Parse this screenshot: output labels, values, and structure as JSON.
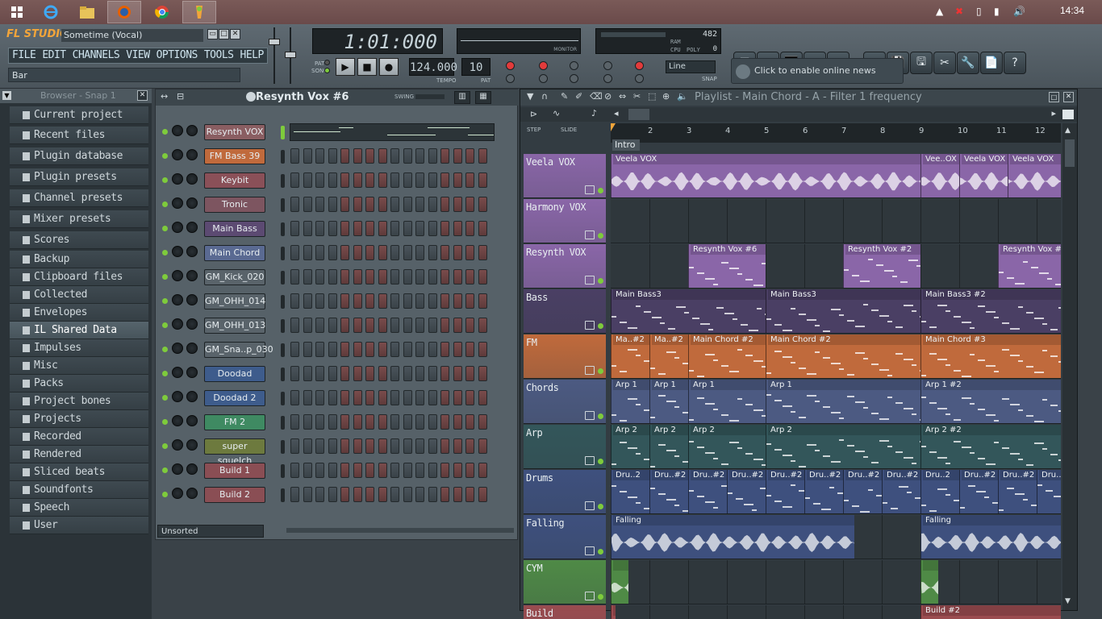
{
  "taskbar": {
    "clock": "14:34",
    "apps": [
      "windows-start",
      "internet-explorer",
      "file-explorer",
      "firefox",
      "chrome",
      "fl-studio"
    ]
  },
  "app": {
    "logo": "FL STUDIO",
    "song_title": "Sometime (Vocal)",
    "menu": [
      "FILE",
      "EDIT",
      "CHANNELS",
      "VIEW",
      "OPTIONS",
      "TOOLS",
      "HELP"
    ],
    "hint": "Bar",
    "time_display": "1:01:000",
    "tempo": "124.000",
    "tempo_label": "TEMPO",
    "pattern": "10",
    "pattern_label": "PAT",
    "pat_song": [
      "PAT",
      "SONG"
    ],
    "monitor_label": "MONITOR",
    "cpu": {
      "value": "482",
      "ram_label": "RAM",
      "cpu_label": "CPU",
      "poly_label": "POLY",
      "poly": "0"
    },
    "snap": "Line",
    "snap_label": "SNAP",
    "news": "Click to enable online news"
  },
  "browser": {
    "header": "Browser - Snap 1",
    "active_index": 11,
    "items": [
      "Current project",
      "Recent files",
      "Plugin database",
      "Plugin presets",
      "Channel presets",
      "Mixer presets",
      "Scores",
      "Backup",
      "Clipboard files",
      "Collected",
      "Envelopes",
      "IL Shared Data",
      "Impulses",
      "Misc",
      "Packs",
      "Project bones",
      "Projects",
      "Recorded",
      "Rendered",
      "Sliced beats",
      "Soundfonts",
      "Speech",
      "User"
    ]
  },
  "rack": {
    "title": "Resynth Vox #6",
    "swing_label": "SWING",
    "filter": "Unsorted",
    "channels": [
      {
        "name": "Resynth VOX",
        "color": "#8a5e62"
      },
      {
        "name": "FM Bass 39",
        "color": "#c06a3c"
      },
      {
        "name": "Keybit",
        "color": "#8a5058"
      },
      {
        "name": "Tronic",
        "color": "#7d5560"
      },
      {
        "name": "Main Bass",
        "color": "#5c4a72"
      },
      {
        "name": "Main Chord",
        "color": "#5a6a92"
      },
      {
        "name": "GM_Kick_020",
        "color": "#59636a"
      },
      {
        "name": "GM_OHH_014",
        "color": "#59636a"
      },
      {
        "name": "GM_OHH_013",
        "color": "#59636a"
      },
      {
        "name": "GM_Sna..p_030",
        "color": "#59636a"
      },
      {
        "name": "Doodad",
        "color": "#3e5c8c"
      },
      {
        "name": "Doodad 2",
        "color": "#3e5c8c"
      },
      {
        "name": "FM 2",
        "color": "#3f8a62"
      },
      {
        "name": "super squelch",
        "color": "#6d7a3e"
      },
      {
        "name": "Build 1",
        "color": "#8a4e54"
      },
      {
        "name": "Build 2",
        "color": "#8a4e54"
      }
    ]
  },
  "playlist": {
    "title": "Playlist - Main Chord - A - Filter 1 frequency",
    "step_label": "STEP",
    "slide_label": "SLIDE",
    "marker": "Intro",
    "bars": [
      "2",
      "3",
      "4",
      "5",
      "6",
      "7",
      "8",
      "9",
      "10",
      "11",
      "12"
    ],
    "tracks": [
      {
        "name": "Veela VOX",
        "color": "#8a66a8",
        "clips": [
          {
            "label": "Veela VOX",
            "start": 0,
            "len": 8,
            "kind": "audio"
          },
          {
            "label": "Vee..OX",
            "start": 8,
            "len": 1,
            "kind": "audio"
          },
          {
            "label": "Veela VOX",
            "start": 9,
            "len": 1.25,
            "kind": "audio"
          },
          {
            "label": "Veela VOX",
            "start": 10.25,
            "len": 1.5,
            "kind": "audio"
          }
        ]
      },
      {
        "name": "Harmony VOX",
        "color": "#8a66a8",
        "clips": []
      },
      {
        "name": "Resynth VOX",
        "color": "#8a66a8",
        "clips": [
          {
            "label": "Resynth Vox #6",
            "start": 2,
            "len": 2,
            "kind": "pattern"
          },
          {
            "label": "Resynth Vox #2",
            "start": 6,
            "len": 2,
            "kind": "pattern"
          },
          {
            "label": "Resynth Vox #",
            "start": 10,
            "len": 1.75,
            "kind": "pattern"
          }
        ]
      },
      {
        "name": "Bass",
        "color": "#4a3f64",
        "clips": [
          {
            "label": "Main Bass3",
            "start": 0,
            "len": 4,
            "kind": "pattern"
          },
          {
            "label": "Main Bass3",
            "start": 4,
            "len": 4,
            "kind": "pattern"
          },
          {
            "label": "Main Bass3 #2",
            "start": 8,
            "len": 3.75,
            "kind": "pattern"
          }
        ]
      },
      {
        "name": "FM",
        "color": "#c06a3c",
        "clips": [
          {
            "label": "Ma..#2",
            "start": 0,
            "len": 1,
            "kind": "pattern"
          },
          {
            "label": "Ma..#2",
            "start": 1,
            "len": 1,
            "kind": "pattern"
          },
          {
            "label": "Main Chord #2",
            "start": 2,
            "len": 2,
            "kind": "pattern"
          },
          {
            "label": "Main Chord #2",
            "start": 4,
            "len": 4,
            "kind": "pattern"
          },
          {
            "label": "Main Chord #3",
            "start": 8,
            "len": 3.75,
            "kind": "pattern"
          }
        ]
      },
      {
        "name": "Chords",
        "color": "#4c5a82",
        "clips": [
          {
            "label": "Arp 1",
            "start": 0,
            "len": 1,
            "kind": "pattern"
          },
          {
            "label": "Arp 1",
            "start": 1,
            "len": 1,
            "kind": "pattern"
          },
          {
            "label": "Arp 1",
            "start": 2,
            "len": 2,
            "kind": "pattern"
          },
          {
            "label": "Arp 1",
            "start": 4,
            "len": 4,
            "kind": "pattern"
          },
          {
            "label": "Arp 1 #2",
            "start": 8,
            "len": 3.75,
            "kind": "pattern"
          }
        ]
      },
      {
        "name": "Arp",
        "color": "#33565a",
        "clips": [
          {
            "label": "Arp 2",
            "start": 0,
            "len": 1,
            "kind": "pattern"
          },
          {
            "label": "Arp 2",
            "start": 1,
            "len": 1,
            "kind": "pattern"
          },
          {
            "label": "Arp 2",
            "start": 2,
            "len": 2,
            "kind": "pattern"
          },
          {
            "label": "Arp 2",
            "start": 4,
            "len": 4,
            "kind": "pattern"
          },
          {
            "label": "Arp 2 #2",
            "start": 8,
            "len": 3.75,
            "kind": "pattern"
          }
        ]
      },
      {
        "name": "Drums",
        "color": "#3e507e",
        "clips": [
          {
            "label": "Dru..2",
            "start": 0,
            "len": 1,
            "kind": "pattern"
          },
          {
            "label": "Dru..#2",
            "start": 1,
            "len": 1,
            "kind": "pattern"
          },
          {
            "label": "Dru..#2",
            "start": 2,
            "len": 1,
            "kind": "pattern"
          },
          {
            "label": "Dru..#2",
            "start": 3,
            "len": 1,
            "kind": "pattern"
          },
          {
            "label": "Dru..#2",
            "start": 4,
            "len": 1,
            "kind": "pattern"
          },
          {
            "label": "Dru..#2",
            "start": 5,
            "len": 1,
            "kind": "pattern"
          },
          {
            "label": "Dru..#2",
            "start": 6,
            "len": 1,
            "kind": "pattern"
          },
          {
            "label": "Dru..#2",
            "start": 7,
            "len": 1,
            "kind": "pattern"
          },
          {
            "label": "Dru..2",
            "start": 8,
            "len": 1,
            "kind": "pattern"
          },
          {
            "label": "Dru..#2",
            "start": 9,
            "len": 1,
            "kind": "pattern"
          },
          {
            "label": "Dru..#2",
            "start": 10,
            "len": 1,
            "kind": "pattern"
          },
          {
            "label": "Dru..",
            "start": 11,
            "len": 0.75,
            "kind": "pattern"
          }
        ]
      },
      {
        "name": "Falling",
        "color": "#3e507e",
        "clips": [
          {
            "label": "Falling",
            "start": 0,
            "len": 6.3,
            "kind": "audio"
          },
          {
            "label": "Falling",
            "start": 8,
            "len": 3.75,
            "kind": "audio"
          }
        ]
      },
      {
        "name": "CYM",
        "color": "#4f8a46",
        "clips": [
          {
            "label": "",
            "start": 0,
            "len": 0.45,
            "kind": "audio"
          },
          {
            "label": "",
            "start": 8,
            "len": 0.45,
            "kind": "audio"
          }
        ]
      },
      {
        "name": "Build",
        "color": "#9a4c50",
        "clips": [
          {
            "label": "",
            "start": 0,
            "len": 0.12,
            "kind": "audio"
          },
          {
            "label": "Build #2",
            "start": 8,
            "len": 3.75,
            "kind": "audio"
          }
        ]
      }
    ]
  }
}
